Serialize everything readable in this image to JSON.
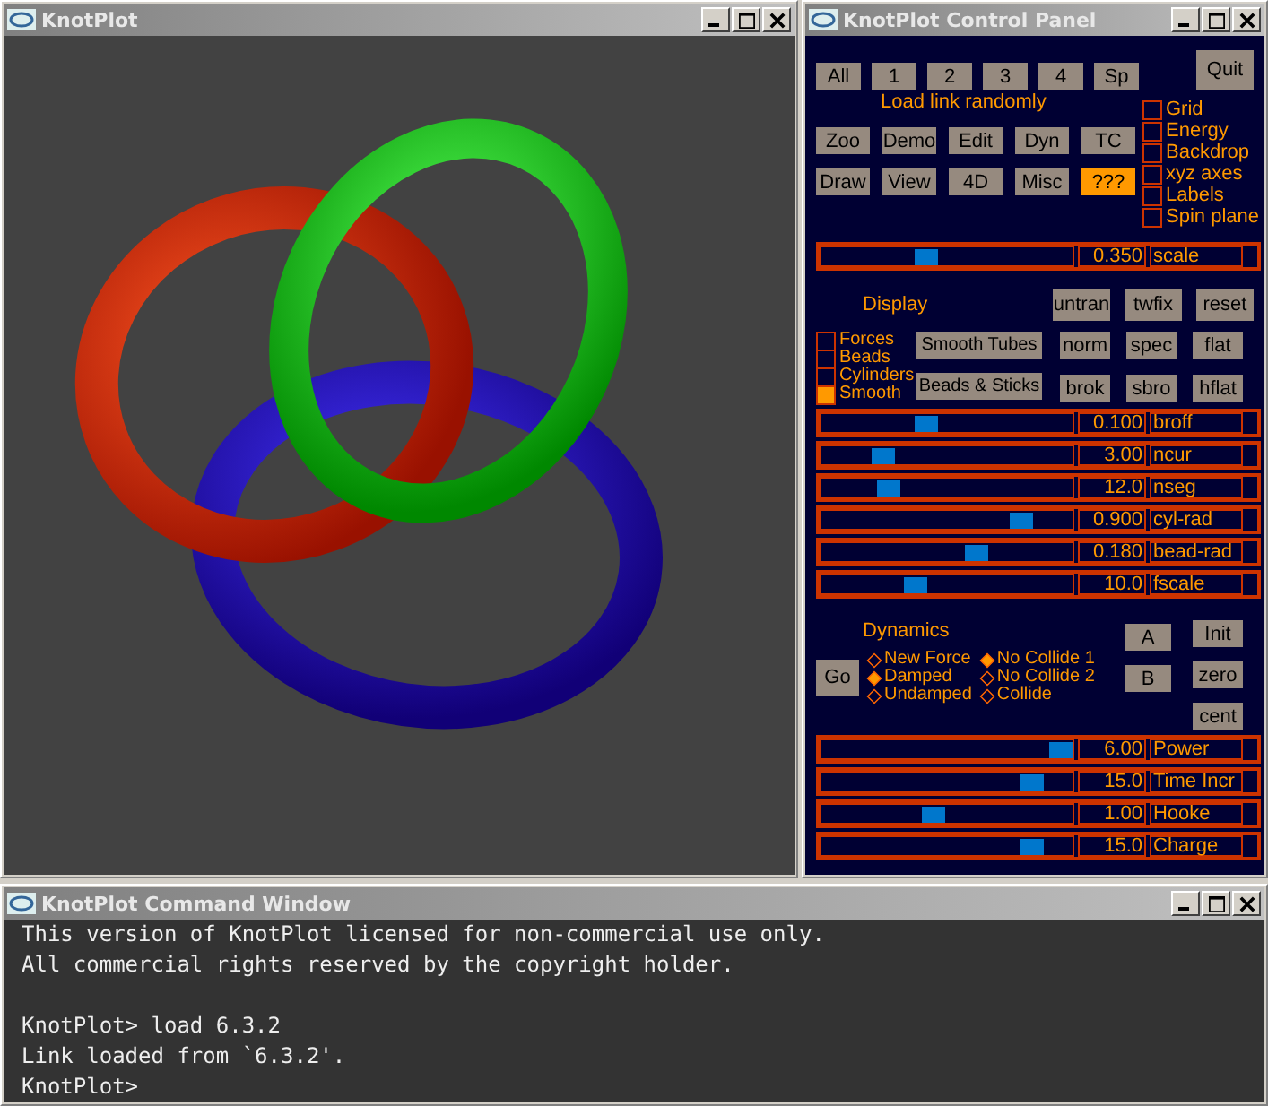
{
  "viewer": {
    "title": "KnotPlot"
  },
  "control_panel": {
    "title": "KnotPlot Control Panel",
    "load_buttons": [
      "All",
      "1",
      "2",
      "3",
      "4",
      "Sp"
    ],
    "load_caption": "Load link randomly",
    "quit_button": "Quit",
    "mode_buttons": [
      {
        "label": "Zoo",
        "selected": false
      },
      {
        "label": "Demo",
        "selected": false
      },
      {
        "label": "Edit",
        "selected": false
      },
      {
        "label": "Dyn",
        "selected": false
      },
      {
        "label": "TC",
        "selected": false
      },
      {
        "label": "Draw",
        "selected": false
      },
      {
        "label": "View",
        "selected": false
      },
      {
        "label": "4D",
        "selected": false
      },
      {
        "label": "Misc",
        "selected": false
      },
      {
        "label": "???",
        "selected": true
      }
    ],
    "options": [
      {
        "label": "Grid",
        "checked": false
      },
      {
        "label": "Energy",
        "checked": false
      },
      {
        "label": "Backdrop",
        "checked": false
      },
      {
        "label": "xyz axes",
        "checked": false
      },
      {
        "label": "Labels",
        "checked": false
      },
      {
        "label": "Spin plane",
        "checked": false
      }
    ],
    "scale_slider": {
      "name": "scale",
      "reading": "0.350",
      "level": 0.42
    },
    "display": {
      "heading": "Display",
      "tool_buttons": [
        "untran",
        "twfix",
        "reset"
      ],
      "styles": [
        {
          "label": "Forces",
          "checked": false
        },
        {
          "label": "Beads",
          "checked": false
        },
        {
          "label": "Cylinders",
          "checked": false
        },
        {
          "label": "Smooth",
          "checked": true
        }
      ],
      "style_buttons": [
        "Smooth Tubes",
        "Beads & Sticks"
      ],
      "shade_buttons": [
        "norm",
        "spec",
        "flat",
        "brok",
        "sbro",
        "hflat"
      ],
      "sliders": [
        {
          "name": "broff",
          "reading": "0.100",
          "level": 0.42
        },
        {
          "name": "ncur",
          "reading": "3.00",
          "level": 0.25
        },
        {
          "name": "nseg",
          "reading": "12.0",
          "level": 0.27
        },
        {
          "name": "cyl-rad",
          "reading": "0.900",
          "level": 0.8
        },
        {
          "name": "bead-rad",
          "reading": "0.180",
          "level": 0.62
        },
        {
          "name": "fscale",
          "reading": "10.0",
          "level": 0.38
        }
      ]
    },
    "dynamics": {
      "heading": "Dynamics",
      "go_button": "Go",
      "damping": [
        {
          "label": "New Force",
          "selected": false
        },
        {
          "label": "Damped",
          "selected": true
        },
        {
          "label": "Undamped",
          "selected": false
        }
      ],
      "collision": [
        {
          "label": "No Collide 1",
          "selected": true
        },
        {
          "label": "No Collide 2",
          "selected": false
        },
        {
          "label": "Collide",
          "selected": false
        }
      ],
      "ab_buttons": [
        "A",
        "B"
      ],
      "side_buttons": [
        "Init",
        "zero",
        "cent"
      ],
      "sliders": [
        {
          "name": "Power",
          "reading": "6.00",
          "level": 0.96
        },
        {
          "name": "Time Incr",
          "reading": "15.0",
          "level": 0.84
        },
        {
          "name": "Hooke",
          "reading": "1.00",
          "level": 0.45
        },
        {
          "name": "Charge",
          "reading": "15.0",
          "level": 0.84
        }
      ]
    }
  },
  "command_window": {
    "title": "KnotPlot Command Window",
    "blocks": [
      [
        "This version of KnotPlot licensed for non-commercial use only.",
        "All commercial rights reserved by the copyright holder."
      ],
      [
        "KnotPlot> load 6.3.2",
        "Link loaded from `6.3.2'.",
        "KnotPlot>"
      ]
    ]
  }
}
